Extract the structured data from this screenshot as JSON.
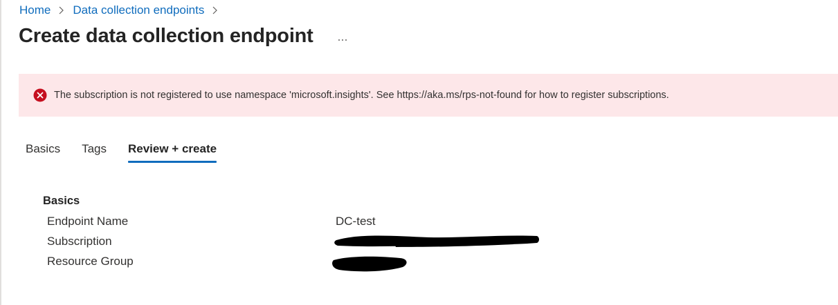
{
  "breadcrumb": {
    "items": [
      {
        "label": "Home"
      },
      {
        "label": "Data collection endpoints"
      }
    ]
  },
  "page": {
    "title": "Create data collection endpoint",
    "more_label": "..."
  },
  "error_banner": {
    "message": "The subscription is not registered to use namespace 'microsoft.insights'. See https://aka.ms/rps-not-found for how to register subscriptions.",
    "icon": "error-circle-icon",
    "color": "#c50f1f",
    "background": "#fde7e9"
  },
  "tabs": [
    {
      "label": "Basics",
      "active": false
    },
    {
      "label": "Tags",
      "active": false
    },
    {
      "label": "Review + create",
      "active": true
    }
  ],
  "review": {
    "section_title": "Basics",
    "rows": [
      {
        "label": "Endpoint Name",
        "value": "DC-test"
      },
      {
        "label": "Subscription",
        "value": ""
      },
      {
        "label": "Resource Group",
        "value": ""
      }
    ]
  },
  "colors": {
    "accent": "#0f6cbd",
    "text": "#323130"
  }
}
